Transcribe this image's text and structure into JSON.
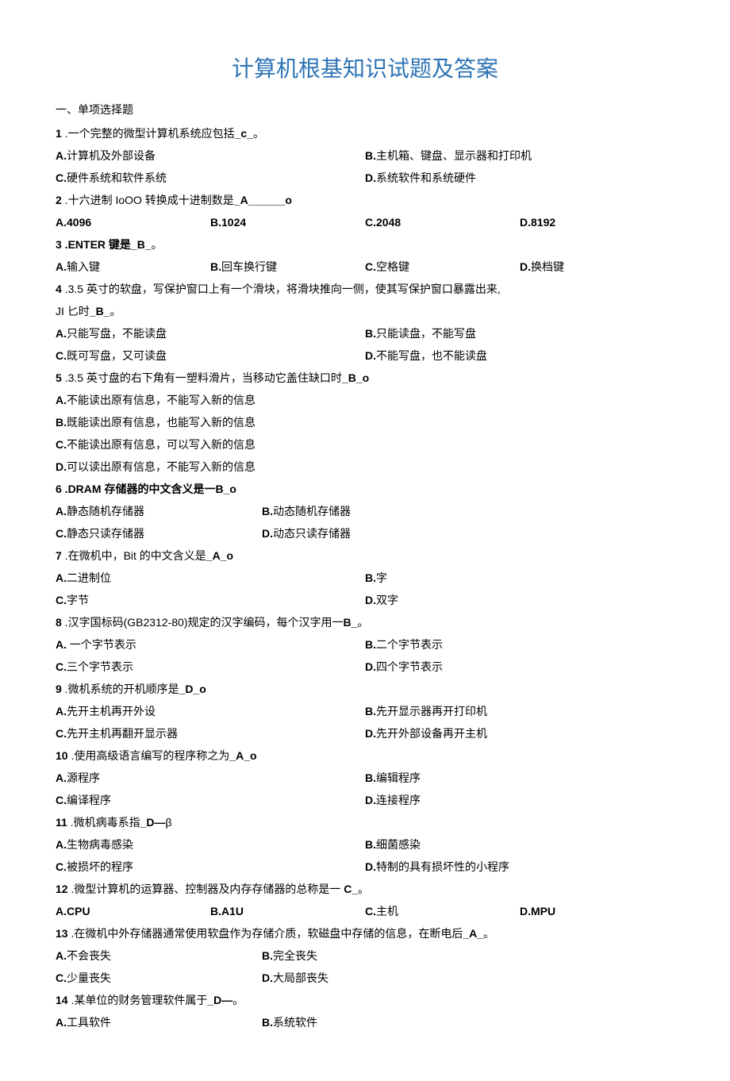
{
  "title": "计算机根基知识试题及答案",
  "section_head": "一、单项选择题",
  "questions": [
    {
      "num": "1",
      "pre": " .一个完整的微型计算机系统应包括",
      "ans": "_c_",
      "post": "。",
      "opts": [
        {
          "k": "A.",
          "t": "计算机及外部设备",
          "w": "w50"
        },
        {
          "k": "B.",
          "t": "主机箱、键盘、显示器和打印机",
          "w": "w50"
        },
        {
          "k": "C.",
          "t": "硬件系统和软件系统",
          "w": "w50"
        },
        {
          "k": "D.",
          "t": "系统软件和系统硬件",
          "w": "w50"
        }
      ]
    },
    {
      "num": "2",
      "pre": " .十六进制 IoOO 转换成十进制数是",
      "ans": "_A______o",
      "post": "",
      "opts": [
        {
          "k": "A.",
          "t": "4096",
          "w": "w25",
          "allbold": true
        },
        {
          "k": "B.",
          "t": "1024",
          "w": "w25",
          "allbold": true
        },
        {
          "k": "C.",
          "t": "2048",
          "w": "w25",
          "allbold": true
        },
        {
          "k": "D.",
          "t": "8192",
          "w": "w25",
          "allbold": true
        }
      ]
    },
    {
      "num": "3",
      "pre": "   .ENTER 键是",
      "ans": "_B_",
      "post": "。",
      "stembold": true,
      "opts": [
        {
          "k": "A.",
          "t": "输入键",
          "w": "w25"
        },
        {
          "k": "B.",
          "t": "回车换行键",
          "w": "w25"
        },
        {
          "k": "C.",
          "t": "空格键",
          "w": "w25"
        },
        {
          "k": "D.",
          "t": "换档键",
          "w": "w25"
        }
      ]
    },
    {
      "num": "4",
      "pre": "   .3.5 英寸的软盘，写保护窗口上有一个滑块，将滑块推向一侧，使其写保护窗口暴露出来,",
      "ans": "",
      "post": "",
      "extra_line_pre": "JI 匕时",
      "extra_line_ans": "_B_",
      "extra_line_post": "。",
      "opts": [
        {
          "k": "A.",
          "t": "只能写盘，不能读盘",
          "w": "w50"
        },
        {
          "k": "B.",
          "t": "只能读盘，不能写盘",
          "w": "w50"
        },
        {
          "k": "C.",
          "t": "既可写盘，又可读盘",
          "w": "w50"
        },
        {
          "k": "D.",
          "t": "不能写盘，也不能读盘",
          "w": "w50"
        }
      ]
    },
    {
      "num": "5",
      "pre": "   .3.5 英寸盘的右下角有一塑料滑片，当移动它盖住缺口时",
      "ans": "_B_o",
      "post": "",
      "opts": [
        {
          "k": "A.",
          "t": "不能读出原有信息，不能写入新的信息",
          "w": "w100"
        },
        {
          "k": "B.",
          "t": "既能读出原有信息，也能写入新的信息",
          "w": "w100"
        },
        {
          "k": "C.",
          "t": "不能读出原有信息，可以写入新的信息",
          "w": "w100"
        },
        {
          "k": "D.",
          "t": "可以读出原有信息，不能写入新的信息",
          "w": "w100"
        }
      ]
    },
    {
      "num": "6",
      "pre": "   .DRAM 存储器的中文含义是一",
      "ans": "B_o",
      "post": "",
      "stembold": true,
      "opts": [
        {
          "k": "A.",
          "t": "静态随机存储器",
          "w": "w33"
        },
        {
          "k": "B.",
          "t": "动态随机存储器",
          "w": "w33"
        },
        {
          "k": "",
          "t": "",
          "w": "w33"
        },
        {
          "k": "C.",
          "t": "静态只读存储器",
          "w": "w33"
        },
        {
          "k": "D.",
          "t": "动态只读存储器",
          "w": "w33"
        }
      ]
    },
    {
      "num": "7",
      "pre": "   .在微机中，Bit 的中文含义是",
      "ans": "_A_o",
      "post": "",
      "opts": [
        {
          "k": "A.",
          "t": "二进制位",
          "w": "w50"
        },
        {
          "k": "B.",
          "t": "字",
          "w": "w50"
        },
        {
          "k": "C.",
          "t": "字节",
          "w": "w50"
        },
        {
          "k": "D.",
          "t": "双字",
          "w": "w50"
        }
      ]
    },
    {
      "num": "8",
      "pre": "   .汉字国标码(GB2312-80)规定的汉字编码，每个汉字用一",
      "ans": "B_",
      "post": "。",
      "opts": [
        {
          "k": "A.",
          "t": "  一个字节表示",
          "w": "w50"
        },
        {
          "k": "B.",
          "t": "二个字节表示",
          "w": "w50"
        },
        {
          "k": "C.",
          "t": "三个字节表示",
          "w": "w50"
        },
        {
          "k": "D.",
          "t": "四个字节表示",
          "w": "w50"
        }
      ]
    },
    {
      "num": "9",
      "pre": "   .微机系统的开机顺序是",
      "ans": "_D_o",
      "post": "",
      "opts": [
        {
          "k": "A.",
          "t": "先开主机再开外设",
          "w": "w50"
        },
        {
          "k": "B.",
          "t": "先开显示器再开打印机",
          "w": "w50"
        },
        {
          "k": "C.",
          "t": "先开主机再翻开显示器",
          "w": "w50"
        },
        {
          "k": "D.",
          "t": "先开外部设备再开主机",
          "w": "w50"
        }
      ]
    },
    {
      "num": "10",
      "pre": "   .使用高级语言编写的程序称之为",
      "ans": "_A_o",
      "post": "",
      "opts": [
        {
          "k": "A.",
          "t": "源程序",
          "w": "w50"
        },
        {
          "k": "B.",
          "t": "编辑程序",
          "w": "w50"
        },
        {
          "k": "C.",
          "t": "编译程序",
          "w": "w50"
        },
        {
          "k": "D.",
          "t": "连接程序",
          "w": "w50"
        }
      ]
    },
    {
      "num": "11",
      "pre": " .微机病毒系指",
      "ans": "_D—",
      "post": "β",
      "opts": [
        {
          "k": "A.",
          "t": "生物病毒感染",
          "w": "w50"
        },
        {
          "k": "B.",
          "t": "细菌感染",
          "w": "w50"
        },
        {
          "k": "C.",
          "t": "被损坏的程序",
          "w": "w50"
        },
        {
          "k": "D.",
          "t": "特制的具有损坏性的小程序",
          "w": "w50"
        }
      ]
    },
    {
      "num": "12",
      "pre": "   .微型计算机的运算器、控制器及内存存储器的总称是一 ",
      "ans": "C_",
      "post": "。",
      "opts": [
        {
          "k": "A.",
          "t": "CPU",
          "w": "w25",
          "allbold": true
        },
        {
          "k": "B.",
          "t": "A1U",
          "w": "w25",
          "allbold": true
        },
        {
          "k": "C.",
          "t": "主机",
          "w": "w25"
        },
        {
          "k": "D.",
          "t": "MPU",
          "w": "w25",
          "allbold": true
        }
      ]
    },
    {
      "num": "13",
      "pre": "   .在微机中外存储器通常使用软盘作为存储介质，软磁盘中存储的信息，在断电后",
      "ans": "_A_",
      "post": "。",
      "opts": [
        {
          "k": "A.",
          "t": "不会丧失",
          "w": "w33"
        },
        {
          "k": "B.",
          "t": "完全丧失",
          "w": "w33"
        },
        {
          "k": "",
          "t": "",
          "w": "w33"
        },
        {
          "k": "C.",
          "t": "少量丧失",
          "w": "w33"
        },
        {
          "k": "D.",
          "t": "大局部丧失",
          "w": "w33"
        }
      ]
    },
    {
      "num": "14",
      "pre": "   .某单位的财务管理软件属于",
      "ans": "_D—",
      "post": "。",
      "opts": [
        {
          "k": "A.",
          "t": "工具软件",
          "w": "w33"
        },
        {
          "k": "B.",
          "t": "系统软件",
          "w": "w33"
        }
      ]
    }
  ]
}
